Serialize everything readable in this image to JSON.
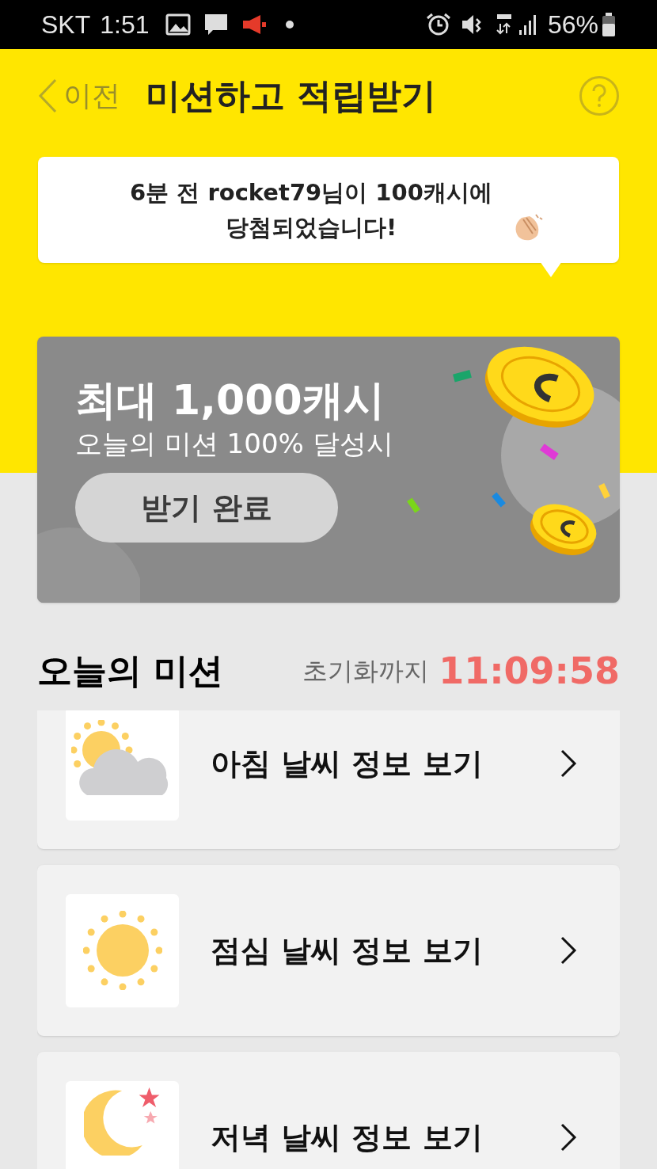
{
  "status_bar": {
    "carrier": "SKT",
    "time": "1:51",
    "battery": "56%"
  },
  "header": {
    "back_label": "이전",
    "title": "미션하고 적립받기"
  },
  "notice": {
    "text": "6분 전 rocket79님이 **100**캐시에 당첨되었습니다!"
  },
  "banner": {
    "title": "최대 1,000캐시",
    "subtitle": "오늘의 미션 100% 달성시",
    "button": {
      "label": "받기 완료",
      "completed": true
    }
  },
  "missions_section": {
    "title": "오늘의 미션",
    "reset_label": "초기화까지",
    "countdown": "11:09:58"
  },
  "missions": [
    {
      "kind": "cloud_sun",
      "label": "아침 날씨 정보 보기"
    },
    {
      "kind": "sun",
      "label": "점심 날씨 정보 보기"
    },
    {
      "kind": "moon",
      "label": "저녁 날씨 정보 보기"
    }
  ]
}
